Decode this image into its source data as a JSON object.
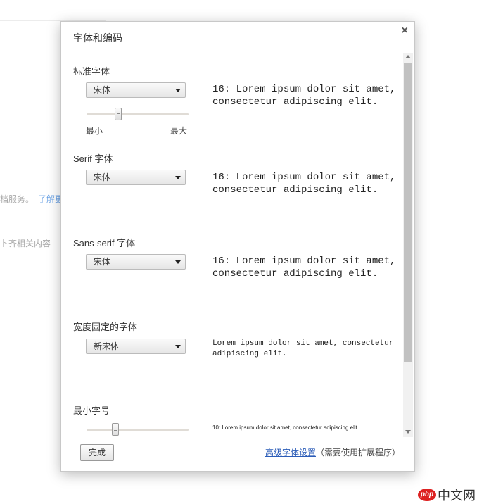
{
  "background": {
    "text1": "档服务。",
    "link1": "了解更",
    "text2": "卜齐相关内容"
  },
  "watermark": {
    "logo": "php",
    "text": "中文网"
  },
  "dialog": {
    "title": "字体和编码",
    "close_glyph": "×"
  },
  "sections": {
    "standard": {
      "label": "标准字体",
      "select_value": "宋体",
      "preview": "16: Lorem ipsum dolor sit amet, consectetur adipiscing elit.",
      "slider_fraction": 0.31,
      "min_label": "最小",
      "max_label": "最大"
    },
    "serif": {
      "label": "Serif 字体",
      "select_value": "宋体",
      "preview": "16: Lorem ipsum dolor sit amet, consectetur adipiscing elit."
    },
    "sans_serif": {
      "label": "Sans-serif 字体",
      "select_value": "宋体",
      "preview": "16: Lorem ipsum dolor sit amet, consectetur adipiscing elit."
    },
    "fixed_width": {
      "label": "宽度固定的字体",
      "select_value": "新宋体",
      "preview": "Lorem ipsum dolor sit amet, consectetur adipiscing elit."
    },
    "minimum_size": {
      "label": "最小字号",
      "slider_fraction": 0.28,
      "preview": "10: Lorem ipsum dolor sit amet, consectetur adipiscing elit."
    }
  },
  "footer": {
    "done_label": "完成",
    "advanced_link": "高级字体设置",
    "advanced_note": "（需要使用扩展程序）"
  }
}
